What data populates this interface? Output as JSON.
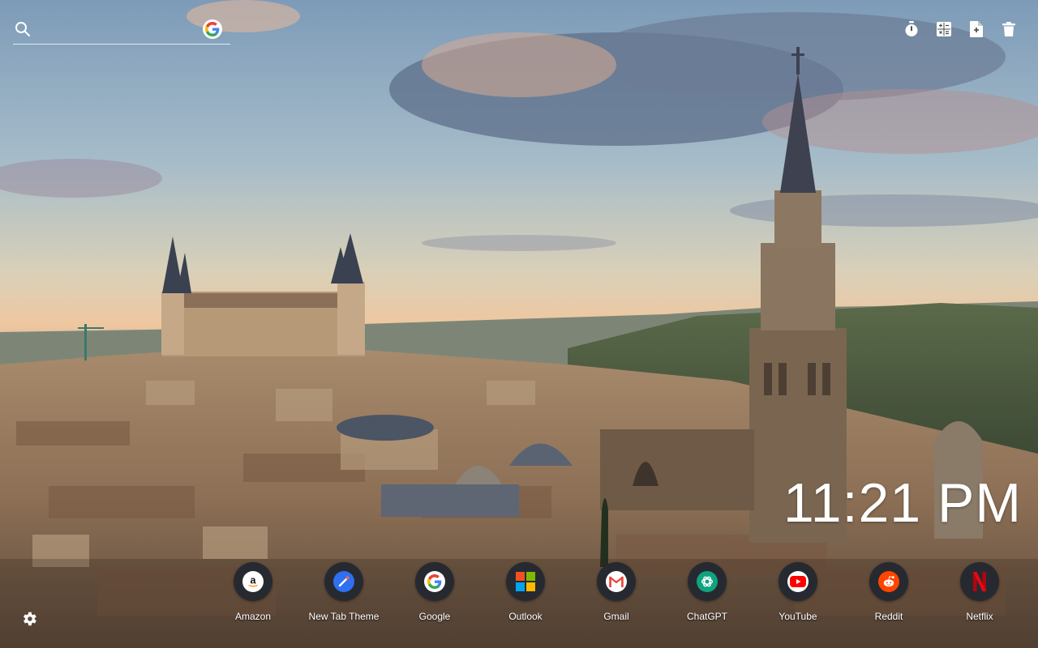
{
  "search": {
    "placeholder": ""
  },
  "toolbar": {
    "icons": [
      "timer-icon",
      "calculator-icon",
      "document-icon",
      "trash-icon"
    ]
  },
  "clock": {
    "time": "11:21 PM"
  },
  "shortcuts": [
    {
      "label": "Amazon",
      "icon": "amazon-icon",
      "color": "#ffffff"
    },
    {
      "label": "New Tab Theme",
      "icon": "new-tab-theme-icon",
      "color": "#2f6ff2"
    },
    {
      "label": "Google",
      "icon": "google-icon",
      "color": "#ffffff"
    },
    {
      "label": "Outlook",
      "icon": "microsoft-icon",
      "color": "#ffffff"
    },
    {
      "label": "Gmail",
      "icon": "gmail-icon",
      "color": "#ffffff"
    },
    {
      "label": "ChatGPT",
      "icon": "chatgpt-icon",
      "color": "#10a37f"
    },
    {
      "label": "YouTube",
      "icon": "youtube-icon",
      "color": "#ffffff"
    },
    {
      "label": "Reddit",
      "icon": "reddit-icon",
      "color": "#ff4500"
    },
    {
      "label": "Netflix",
      "icon": "netflix-icon",
      "color": "#e50914"
    }
  ],
  "colors": {
    "accent_text": "#ffffff",
    "shortcut_bg": "#262a30"
  }
}
